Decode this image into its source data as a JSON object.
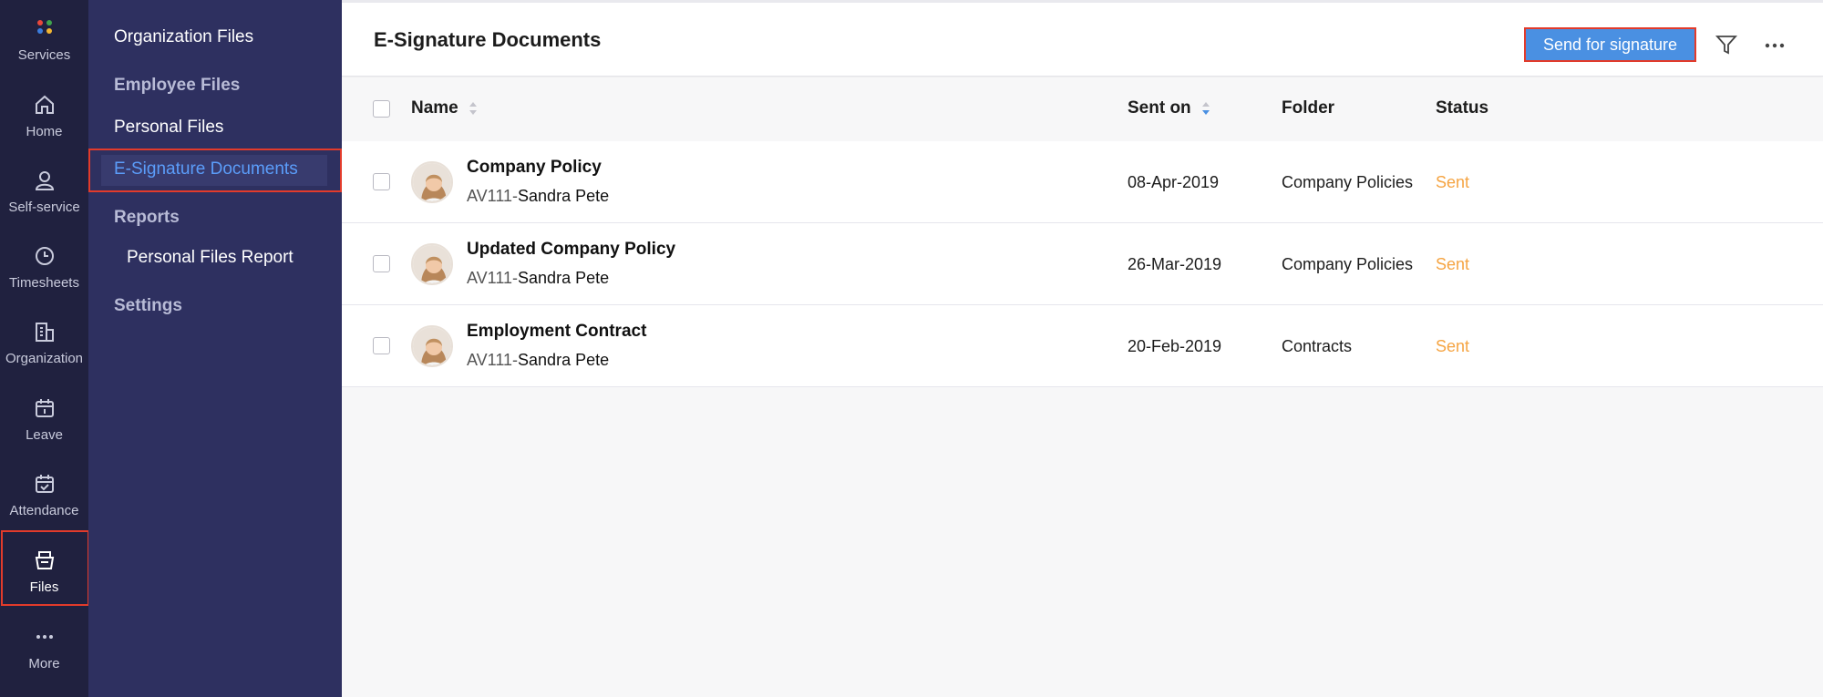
{
  "rail": {
    "items": [
      {
        "label": "Services",
        "icon": "services-icon"
      },
      {
        "label": "Home",
        "icon": "home-icon"
      },
      {
        "label": "Self-service",
        "icon": "user-icon"
      },
      {
        "label": "Timesheets",
        "icon": "clock-icon"
      },
      {
        "label": "Organization",
        "icon": "building-icon"
      },
      {
        "label": "Leave",
        "icon": "calendar-icon"
      },
      {
        "label": "Attendance",
        "icon": "calendar-check-icon"
      },
      {
        "label": "Files",
        "icon": "files-icon"
      },
      {
        "label": "More",
        "icon": "ellipsis-icon"
      }
    ],
    "active": "Files"
  },
  "submenu": {
    "organization_files": "Organization Files",
    "employee_files": "Employee Files",
    "personal_files": "Personal Files",
    "esignature_documents": "E-Signature Documents",
    "reports": "Reports",
    "personal_files_report": "Personal Files Report",
    "settings": "Settings"
  },
  "header": {
    "title": "E-Signature Documents",
    "send_button": "Send for signature"
  },
  "table": {
    "columns": {
      "name": "Name",
      "sent_on": "Sent on",
      "folder": "Folder",
      "status": "Status"
    },
    "rows": [
      {
        "name": "Company Policy",
        "employee_id": "AV111-",
        "employee_name": "Sandra Pete",
        "sent_on": "08-Apr-2019",
        "folder": "Company Policies",
        "status": "Sent"
      },
      {
        "name": "Updated Company Policy",
        "employee_id": "AV111-",
        "employee_name": "Sandra Pete",
        "sent_on": "26-Mar-2019",
        "folder": "Company Policies",
        "status": "Sent"
      },
      {
        "name": "Employment Contract",
        "employee_id": "AV111-",
        "employee_name": "Sandra Pete",
        "sent_on": "20-Feb-2019",
        "folder": "Contracts",
        "status": "Sent"
      }
    ]
  },
  "colors": {
    "rail_bg": "#20213f",
    "submenu_bg": "#2e3060",
    "accent": "#4a90e2",
    "active_link": "#5b9dfa",
    "status_sent": "#f5a442",
    "highlight": "#e23b2b"
  }
}
